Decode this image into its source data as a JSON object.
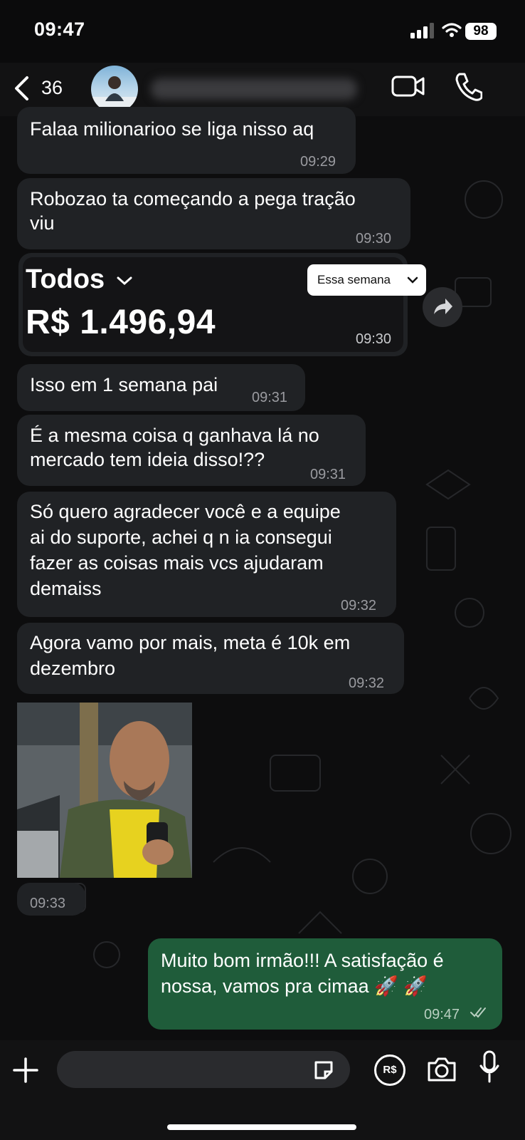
{
  "status_bar": {
    "time": "09:47",
    "battery": "98",
    "signal_icon": "cellular-signal-icon",
    "wifi_icon": "wifi-icon"
  },
  "header": {
    "unread_count": "36",
    "back_icon": "chevron-left-icon",
    "video_icon": "video-call-icon",
    "call_icon": "phone-call-icon"
  },
  "messages": [
    {
      "text_lines": [
        "Falaa milionarioo se liga nisso aq"
      ],
      "time": "09:29"
    },
    {
      "text_lines": [
        "Robozao ta começando a pega tração",
        "viu"
      ],
      "time": "09:30"
    },
    {
      "card": {
        "title": "Todos",
        "range": "Essa semana",
        "amount": "R$ 1.496,94"
      },
      "time": "09:30"
    },
    {
      "text_lines": [
        "Isso em 1 semana pai"
      ],
      "time": "09:31"
    },
    {
      "text_lines": [
        "É a mesma coisa q ganhava lá no",
        "mercado tem ideia disso!??"
      ],
      "time": "09:31"
    },
    {
      "text_lines": [
        "Só quero agradecer você e a equipe",
        "ai do suporte, achei q n ia consegui",
        "fazer as coisas mais vcs ajudaram",
        "demaiss"
      ],
      "time": "09:32"
    },
    {
      "text_lines": [
        "Agora vamo por mais, meta é 10k em",
        "dezembro"
      ],
      "time": "09:32"
    },
    {
      "photo": true,
      "time": "09:33"
    }
  ],
  "outgoing": {
    "text_lines": [
      "Muito bom irmão!!! A satisfação é",
      "nossa, vamos pra cimaa 🚀 🚀"
    ],
    "time": "09:47"
  },
  "composer": {
    "plus_icon": "plus-icon",
    "sticker_icon": "sticker-icon",
    "payment_icon": "payment-icon",
    "payment_label": "R$",
    "camera_icon": "camera-icon",
    "mic_icon": "microphone-icon"
  },
  "colors": {
    "incoming_bubble": "#202225",
    "outgoing_bubble": "#1f5c3a",
    "background": "#0d0d0e"
  }
}
